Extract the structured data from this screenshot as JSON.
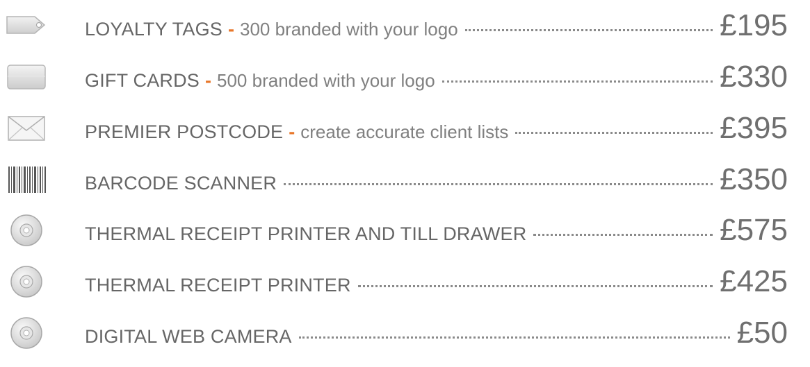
{
  "items": [
    {
      "title": "LOYALTY TAGS",
      "separator": "-",
      "desc": "300 branded with your logo",
      "price": "£195",
      "icon": "tag-icon"
    },
    {
      "title": "GIFT CARDS",
      "separator": "-",
      "desc": "500 branded with your logo",
      "price": "£330",
      "icon": "card-icon"
    },
    {
      "title": "PREMIER POSTCODE",
      "separator": "-",
      "desc": "create accurate client lists",
      "price": "£395",
      "icon": "envelope-icon"
    },
    {
      "title": "BARCODE SCANNER",
      "separator": "",
      "desc": "",
      "price": "£350",
      "icon": "barcode-icon"
    },
    {
      "title": "THERMAL RECEIPT PRINTER AND TILL DRAWER",
      "separator": "",
      "desc": "",
      "price": "£575",
      "icon": "disc-icon"
    },
    {
      "title": "THERMAL RECEIPT PRINTER",
      "separator": "",
      "desc": "",
      "price": "£425",
      "icon": "disc-icon"
    },
    {
      "title": "DIGITAL WEB CAMERA",
      "separator": "",
      "desc": "",
      "price": "£50",
      "icon": "disc-icon"
    }
  ],
  "colors": {
    "accent": "#e8772a",
    "text": "#666666",
    "dots": "#8a8a8a"
  }
}
